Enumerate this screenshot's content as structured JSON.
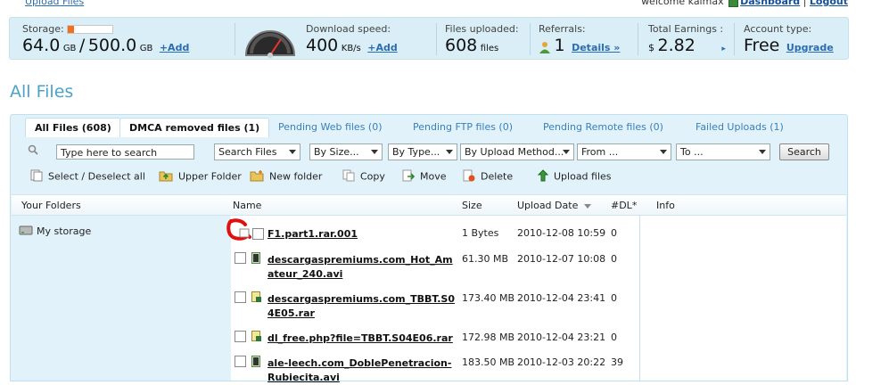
{
  "toplinks": {
    "upload_files": "Upload Files",
    "welcome": "welcome kalmax",
    "dashboard": "Dashboard",
    "separator": "|",
    "logout": "Logout"
  },
  "stats": {
    "storage_label": "Storage:",
    "storage_used": "64.0",
    "storage_used_unit": "GB",
    "storage_slash": "/",
    "storage_total": "500.0",
    "storage_total_unit": "GB",
    "storage_add": "+Add",
    "storage_used_fraction": 0.128,
    "download_label": "Download speed:",
    "download_value": "400",
    "download_unit": "KB/s",
    "download_add": "+Add",
    "files_label": "Files uploaded:",
    "files_value": "608",
    "files_unit": "files",
    "referrals_label": "Referrals:",
    "referrals_value": "1",
    "referrals_details": "Details »",
    "earnings_label": "Total Earnings :",
    "earnings_currency": "$",
    "earnings_value": "2.82",
    "earnings_arrow": "▸",
    "account_label": "Account type:",
    "account_value": "Free",
    "account_upgrade": "Upgrade"
  },
  "page_title": "All Files",
  "tabs": [
    {
      "label": "All Files (608)"
    },
    {
      "label": "DMCA removed files (1)"
    },
    {
      "label": "Pending Web files (0)"
    },
    {
      "label": "Pending FTP files (0)"
    },
    {
      "label": "Pending Remote files (0)"
    },
    {
      "label": "Failed Uploads (1)"
    }
  ],
  "toolbar": {
    "search_placeholder": "Type here to search",
    "search_files": "Search Files",
    "by_size": "By Size...",
    "by_type": "By Type...",
    "by_upload_method": "By Upload Method...",
    "from": "From ...",
    "to": "To ...",
    "search_button": "Search",
    "select_deselect": "Select / Deselect all",
    "upper_folder": "Upper Folder",
    "new_folder": "New folder",
    "copy": "Copy",
    "move": "Move",
    "delete": "Delete",
    "upload_files": "Upload files"
  },
  "columns": {
    "your_folders": "Your Folders",
    "name": "Name",
    "size": "Size",
    "upload_date": "Upload Date",
    "downloads": "#DL*",
    "info": "Info"
  },
  "folders": [
    {
      "label": "My storage"
    }
  ],
  "files": [
    {
      "name": "F1.part1.rar.001",
      "size": "1 Bytes",
      "date": "2010-12-08 10:59",
      "dl": "0",
      "icon": "folder-icon"
    },
    {
      "name": "descargaspremiums.com_Hot_Amateur_240.avi",
      "size": "61.30 MB",
      "date": "2010-12-07 10:08",
      "dl": "0",
      "icon": "video-file-icon"
    },
    {
      "name": "descargaspremiums.com_TBBT.S04E05.rar",
      "size": "173.40 MB",
      "date": "2010-12-04 23:41",
      "dl": "0",
      "icon": "archive-file-icon"
    },
    {
      "name": "dl_free.php?file=TBBT.S04E06.rar",
      "size": "172.98 MB",
      "date": "2010-12-04 23:21",
      "dl": "0",
      "icon": "archive-file-icon"
    },
    {
      "name": "ale-leech.com_DoblePenetracion-Rubiecita.avi",
      "size": "183.50 MB",
      "date": "2010-12-03 20:22",
      "dl": "39",
      "icon": "video-file-icon"
    }
  ],
  "colors": {
    "accent": "#4aa3c9",
    "link": "#2b6db3",
    "panel": "#e2f2fa",
    "stats_bar": "#d9eef6",
    "storage_bar_fill": "#f07020",
    "annotation_red": "#e01010"
  }
}
